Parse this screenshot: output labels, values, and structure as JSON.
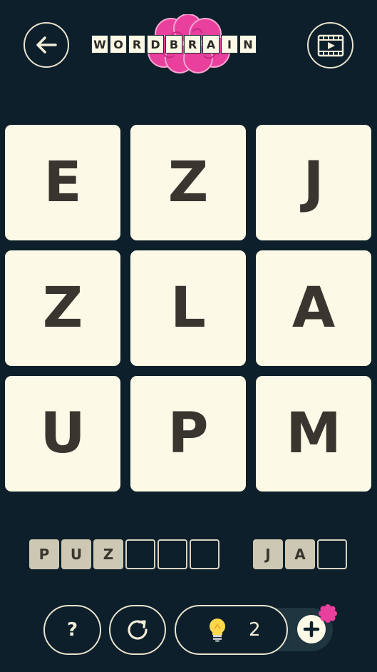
{
  "header": {
    "back_icon": "arrow-left-icon",
    "video_icon": "video-play-icon",
    "logo_letters": [
      "W",
      "O",
      "R",
      "D",
      "B",
      "R",
      "A",
      "I",
      "N"
    ]
  },
  "grid": {
    "letters": [
      "E",
      "Z",
      "J",
      "Z",
      "L",
      "A",
      "U",
      "P",
      "M"
    ]
  },
  "answers": {
    "word1": [
      "P",
      "U",
      "Z",
      "",
      "",
      ""
    ],
    "word2": [
      "J",
      "A",
      ""
    ]
  },
  "bottom": {
    "help_label": "?",
    "restart_icon": "restart-icon",
    "hint_icon": "lightbulb-icon",
    "hint_count": "2",
    "add_icon": "plus-icon"
  },
  "colors": {
    "background": "#0d1f2a",
    "tile": "#fcfae6",
    "tile_text": "#3b3530",
    "brain_pink": "#e93f9d",
    "filled_slot": "#cdc8b3"
  }
}
